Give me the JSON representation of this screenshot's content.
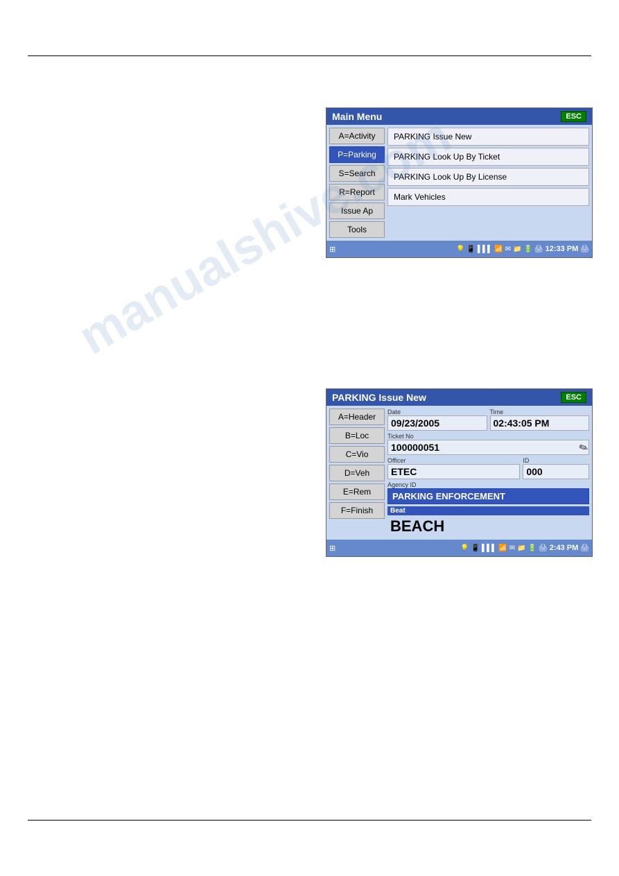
{
  "page": {
    "watermark": "manualshive.com"
  },
  "main_menu": {
    "title": "Main Menu",
    "esc_label": "ESC",
    "left_buttons": [
      {
        "id": "activity",
        "label": "A=Activity",
        "active": false
      },
      {
        "id": "parking",
        "label": "P=Parking",
        "active": true
      },
      {
        "id": "search",
        "label": "S=Search",
        "active": false
      },
      {
        "id": "report",
        "label": "R=Report",
        "active": false
      },
      {
        "id": "issue_ap",
        "label": "Issue Ap",
        "active": false
      },
      {
        "id": "tools",
        "label": "Tools",
        "active": false
      }
    ],
    "right_items": [
      {
        "id": "parking_issue_new",
        "label": "PARKING Issue New"
      },
      {
        "id": "parking_lookup_ticket",
        "label": "PARKING Look Up By Ticket"
      },
      {
        "id": "parking_lookup_license",
        "label": "PARKING Look Up By License"
      },
      {
        "id": "mark_vehicles",
        "label": "Mark Vehicles"
      }
    ],
    "taskbar_time": "12:33 PM"
  },
  "parking_issue": {
    "title": "PARKING Issue New",
    "esc_label": "ESC",
    "left_buttons": [
      {
        "id": "header",
        "label": "A=Header"
      },
      {
        "id": "loc",
        "label": "B=Loc"
      },
      {
        "id": "vio",
        "label": "C=Vio"
      },
      {
        "id": "veh",
        "label": "D=Veh"
      },
      {
        "id": "rem",
        "label": "E=Rem"
      },
      {
        "id": "finish",
        "label": "F=Finish"
      }
    ],
    "date_label": "Date",
    "date_value": "09/23/2005",
    "time_label": "Time",
    "time_value": "02:43:05 PM",
    "ticket_label": "Ticket No",
    "ticket_value": "100000051",
    "officer_label": "Officer",
    "officer_value": "ETEC",
    "id_label": "ID",
    "id_value": "000",
    "agency_label": "Agency ID",
    "agency_value": "PARKING ENFORCEMENT",
    "beat_label": "Beat",
    "beat_value": "BEACH",
    "taskbar_time": "2:43 PM"
  }
}
